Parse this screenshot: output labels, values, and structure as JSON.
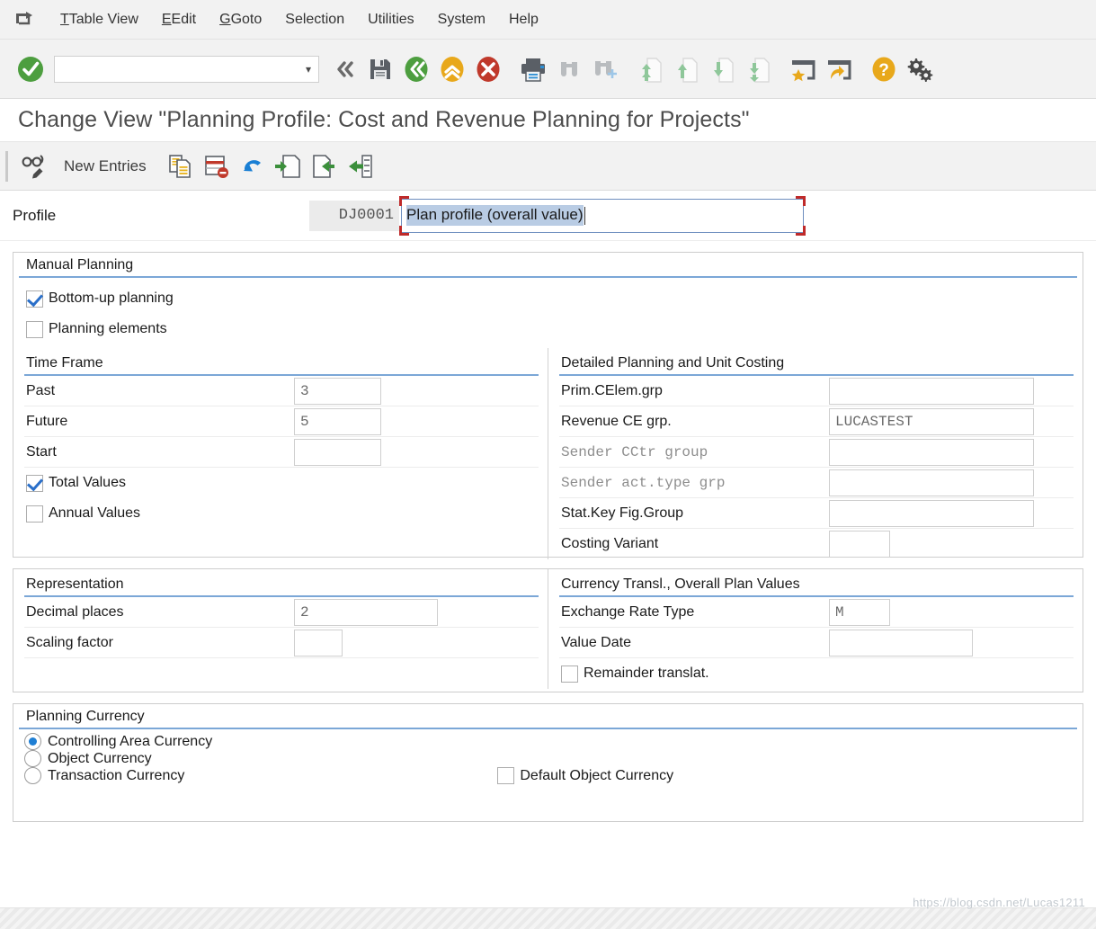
{
  "menu": {
    "system_icon": "window-menu-icon",
    "items": [
      {
        "label": "Table View",
        "accel": "T"
      },
      {
        "label": "Edit",
        "accel": "E"
      },
      {
        "label": "Goto",
        "accel": "G"
      },
      {
        "label": "Selection",
        "accel": "l"
      },
      {
        "label": "Utilities",
        "accel": "s"
      },
      {
        "label": "System",
        "accel": "y"
      },
      {
        "label": "Help",
        "accel": "H"
      }
    ]
  },
  "toolbar": {
    "command_field_value": "",
    "icons": [
      "enter-check-icon",
      "collapse-left-icon",
      "save-icon",
      "back-icon",
      "exit-icon",
      "cancel-icon",
      "print-icon",
      "find-icon",
      "find-next-icon",
      "first-page-icon",
      "previous-page-icon",
      "next-page-icon",
      "last-page-icon",
      "create-session-icon",
      "create-shortcut-icon",
      "help-icon",
      "customize-icon"
    ]
  },
  "title": "Change View \"Planning Profile: Cost and Revenue Planning for Projects\"",
  "app_toolbar": {
    "display_change_icon": "display-change-icon",
    "new_entries_label": "New Entries",
    "icons": [
      "copy-as-icon",
      "delete-icon",
      "undo-icon",
      "previous-entry-icon",
      "next-entry-icon",
      "details-icon"
    ]
  },
  "profile": {
    "label": "Profile",
    "key": "DJ0001",
    "description": "Plan profile (overall value)"
  },
  "manual_planning": {
    "title": "Manual Planning",
    "checkboxes": [
      {
        "label": "Bottom-up planning",
        "checked": true
      },
      {
        "label": "Planning elements",
        "checked": false
      }
    ],
    "time_frame": {
      "title": "Time Frame",
      "fields": [
        {
          "label": "Past",
          "value": "3"
        },
        {
          "label": "Future",
          "value": "5"
        },
        {
          "label": "Start",
          "value": ""
        }
      ],
      "checkboxes": [
        {
          "label": "Total Values",
          "checked": true
        },
        {
          "label": "Annual Values",
          "checked": false
        }
      ]
    },
    "detailed_planning": {
      "title": "Detailed Planning and Unit Costing",
      "fields": [
        {
          "label": "Prim.CElem.grp",
          "value": "",
          "dim": false
        },
        {
          "label": "Revenue CE grp.",
          "value": "LUCASTEST",
          "dim": false
        },
        {
          "label": "Sender CCtr group",
          "value": "",
          "dim": true
        },
        {
          "label": "Sender act.type grp",
          "value": "",
          "dim": true
        },
        {
          "label": "Stat.Key Fig.Group",
          "value": "",
          "dim": false
        },
        {
          "label": "Costing Variant",
          "value": "",
          "dim": false
        }
      ]
    }
  },
  "representation": {
    "title": "Representation",
    "fields": [
      {
        "label": "Decimal places",
        "value": "2"
      },
      {
        "label": "Scaling factor",
        "value": ""
      }
    ]
  },
  "currency_translation": {
    "title": "Currency Transl., Overall Plan Values",
    "fields": [
      {
        "label": "Exchange Rate Type",
        "value": "M"
      },
      {
        "label": "Value Date",
        "value": ""
      }
    ],
    "checkbox": {
      "label": "Remainder translat.",
      "checked": false
    }
  },
  "planning_currency": {
    "title": "Planning Currency",
    "options": [
      {
        "label": "Controlling Area Currency",
        "selected": true
      },
      {
        "label": "Object Currency",
        "selected": false
      },
      {
        "label": "Transaction Currency",
        "selected": false
      }
    ],
    "default_object_currency": {
      "label": "Default Object Currency",
      "checked": false
    }
  },
  "watermark": "https://blog.csdn.net/Lucas1211",
  "colors": {
    "accent_blue": "#7ba7d7",
    "toolbar_bg": "#f2f2f2",
    "focus_red": "#bf2a2a",
    "selection_blue": "#b9cce4",
    "green": "#4d9e3f",
    "yellow": "#e8a81b",
    "red": "#c0392b"
  }
}
